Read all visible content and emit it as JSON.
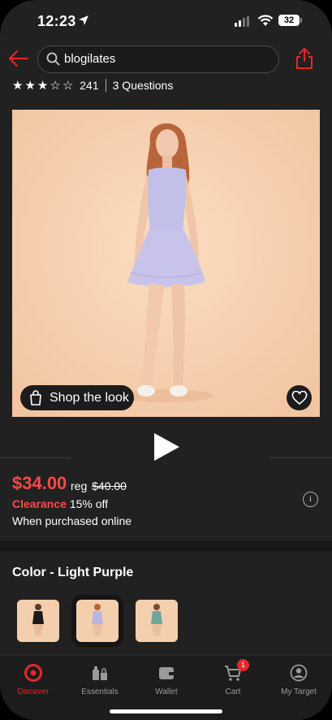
{
  "status_bar": {
    "time": "12:23",
    "battery": "32"
  },
  "search": {
    "query": "blogilates"
  },
  "rating": {
    "stars": [
      "★",
      "★",
      "★",
      "☆",
      "☆"
    ],
    "count": "241",
    "questions": "3 Questions"
  },
  "hero": {
    "shop_label": "Shop the look"
  },
  "price": {
    "current": "$34.00",
    "reg_label": "reg",
    "reg_value": "$40.00",
    "clearance_label": "Clearance",
    "discount": "15% off",
    "note": "When purchased online"
  },
  "color": {
    "title": "Color - Light Purple",
    "swatch_dresses": [
      "#1a1a1a",
      "#b9b6e3",
      "#6aa79a"
    ]
  },
  "tabs": [
    {
      "label": "Discover",
      "icon": "target-icon",
      "active": true
    },
    {
      "label": "Essentials",
      "icon": "essentials-icon"
    },
    {
      "label": "Wallet",
      "icon": "wallet-icon"
    },
    {
      "label": "Cart",
      "icon": "cart-icon",
      "badge": "1"
    },
    {
      "label": "My Target",
      "icon": "person-icon"
    }
  ],
  "colors": {
    "accent": "#e8262a",
    "price_red": "#ff4747",
    "background": "#212121"
  }
}
